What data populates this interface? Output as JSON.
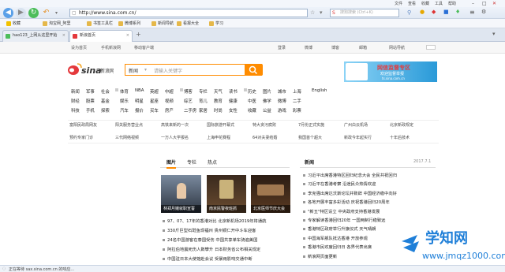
{
  "menubar": {
    "file": "文件",
    "view": "查看",
    "favorites": "收藏",
    "tools": "工具",
    "help": "帮助"
  },
  "toolbar": {
    "address": "http://www.sina.com.cn/",
    "search_placeholder": "搜狗搜索 (Ctrl+K)"
  },
  "bookmarks": [
    "收藏",
    "淘宝网_阿里",
    "书签工具栏",
    "微博系列",
    "新闻导航",
    "看报大全",
    "学习"
  ],
  "tabs": [
    {
      "label": "hao123_上网从这里开始"
    },
    {
      "label": "新浪首页"
    }
  ],
  "sitenav": {
    "home": "设为首页",
    "mobile": "手机新浪网",
    "mobile_client": "移动客户端",
    "login": "登录",
    "weibo": "微博",
    "blog": "博客",
    "mail": "邮箱",
    "netnav": "网站导航"
  },
  "search": {
    "select": "新闻",
    "placeholder": "请输入关键字"
  },
  "ad": {
    "title": "网信监督专区",
    "sub": "欢迎监督举报",
    "url": "ts.sina.com.cn"
  },
  "categories": [
    [
      "新闻",
      "军事",
      "社会",
      "体育",
      "NBA",
      "英超",
      "中超",
      "博客",
      "专栏",
      "天气",
      "读书",
      "历史",
      "图片",
      "城市",
      "上海",
      "English"
    ],
    [
      "财经",
      "股票",
      "基金",
      "娱乐",
      "明星",
      "星座",
      "视频",
      "综艺",
      "育儿",
      "教育",
      "健康",
      "中医",
      "佛学",
      "微博",
      "二手"
    ],
    [
      "科技",
      "手机",
      "探索",
      "汽车",
      "报价",
      "买车",
      "房产",
      "二手房",
      "家居",
      "时尚",
      "女性",
      "收藏",
      "公益",
      "游戏",
      "彩票"
    ]
  ],
  "link_rows": [
    [
      "富阳民政局网友",
      "阳关服务营业点",
      "高铁来新的一次",
      "国际旅游开幕式",
      "特大贪污腐败",
      "7月份正式实施",
      "广州白云机场",
      "北京新政规定"
    ],
    [
      "预约专家门诊",
      "三代网络视频",
      "一万人大学报名",
      "上海申花赛程",
      "64对夫妻结婚",
      "我国首个超大",
      "新政今年起实行",
      "十年后技术"
    ]
  ],
  "left_tabs": [
    "图片",
    "专栏",
    "热点"
  ],
  "right_tab": "新闻",
  "right_date": "2017.7.1",
  "thumbs": [
    {
      "caption": "林郑月娥就职宣誓"
    },
    {
      "caption": "南京民警夜班抓"
    },
    {
      "caption": "北京医师节庆大会"
    }
  ],
  "left_news": [
    "97、07、17年的香港对比 北京新机场2019年将通航",
    "330斤巨型石斑鱼现福州 贵州铜仁开中斗车迎客",
    "24名中国游客在泰国受伤 中国共享单车骑遍美国",
    "阿拉伯地震死伤人数攀升 日本财务省公布相关规定",
    "中国驻日本大使馆赴会议 受暴雨影响交通中断"
  ],
  "right_news": [
    "习近平出席香港特区回归纪念大会 全民共祝回归",
    "习近平在香港考察 沿途民众热情欢迎",
    "李克强出席达沃斯论坛并致辞 中国经济稳中向好",
    "各地开展丰富多彩活动 庆祝香港回归20周年",
    "\"新五\"特区设立 中央政府支持香港发展",
    "专家解读香港回归20年 一国两制行稳致远",
    "香港特区政府举行升旗仪式 天气晴朗",
    "中国海军舰队抵达香港 开放参观",
    "香港市民欢度回归日 各界代表出席",
    "新浪网页面更新"
  ],
  "status": {
    "text": "正在等待 sax.sina.com.cn 的响应..."
  },
  "watermark": {
    "main": "学知网",
    "url": "www.jmqz1000.com"
  },
  "colors": {
    "accent": "#ff8c00",
    "brand_red": "#e4393c",
    "link_blue": "#2a6fd6"
  }
}
